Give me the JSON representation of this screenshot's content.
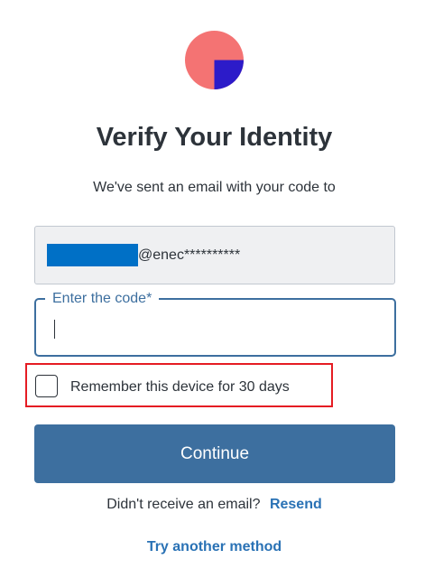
{
  "logo": {
    "name": "brand-logo",
    "colors": {
      "circle": "#f47373",
      "square": "#2c1bc9"
    }
  },
  "header": {
    "title": "Verify Your Identity",
    "subtitle": "We've sent an email with your code to"
  },
  "email": {
    "masked_value": "@enec**********"
  },
  "code_input": {
    "label": "Enter the code*",
    "value": ""
  },
  "remember": {
    "label": "Remember this device for 30 days",
    "checked": false
  },
  "actions": {
    "continue_label": "Continue",
    "resend_prompt": "Didn't receive an email?",
    "resend_label": "Resend",
    "try_another_label": "Try another method"
  },
  "colors": {
    "primary": "#3d6f9f",
    "link": "#2a72b5",
    "highlight": "#e51c23",
    "redaction": "#0070c6"
  }
}
